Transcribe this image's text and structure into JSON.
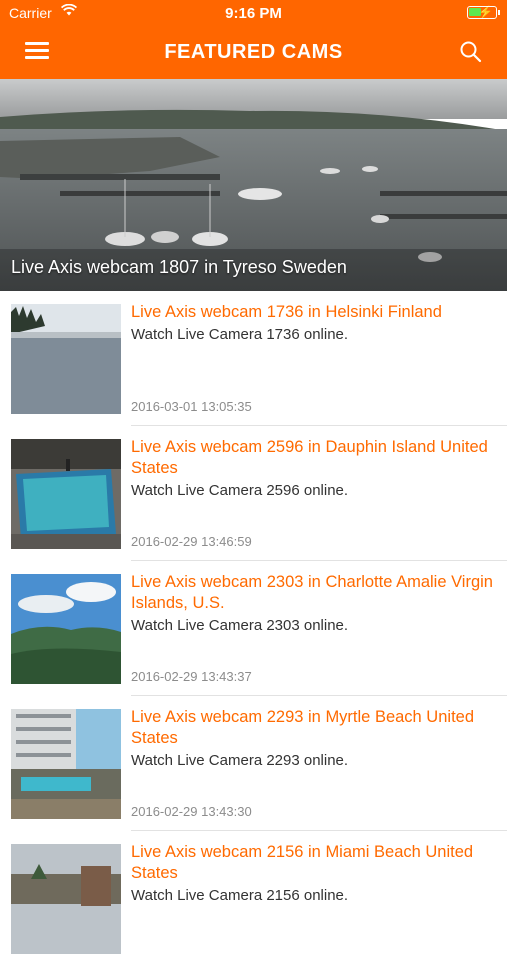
{
  "status_bar": {
    "carrier": "Carrier",
    "time": "9:16 PM"
  },
  "nav": {
    "title": "FEATURED CAMS",
    "menu_icon": "hamburger-icon",
    "search_icon": "search-icon"
  },
  "featured": {
    "title": "Live Axis webcam 1807 in Tyreso Sweden"
  },
  "items": [
    {
      "title": "Live Axis webcam 1736 in Helsinki Finland",
      "description": "Watch Live Camera 1736 online.",
      "date": "2016-03-01 13:05:35"
    },
    {
      "title": "Live Axis webcam 2596 in Dauphin Island United States",
      "description": "Watch Live Camera 2596 online.",
      "date": "2016-02-29 13:46:59"
    },
    {
      "title": "Live Axis webcam 2303 in Charlotte Amalie Virgin Islands, U.S.",
      "description": "Watch Live Camera 2303 online.",
      "date": "2016-02-29 13:43:37"
    },
    {
      "title": "Live Axis webcam 2293 in Myrtle Beach United States",
      "description": "Watch Live Camera 2293 online.",
      "date": "2016-02-29 13:43:30"
    },
    {
      "title": "Live Axis webcam 2156 in Miami Beach United States",
      "description": "Watch Live Camera 2156 online.",
      "date": ""
    }
  ],
  "colors": {
    "accent": "#ff6600",
    "title_text": "#ff6a00",
    "date_text": "#8c8c8c"
  }
}
